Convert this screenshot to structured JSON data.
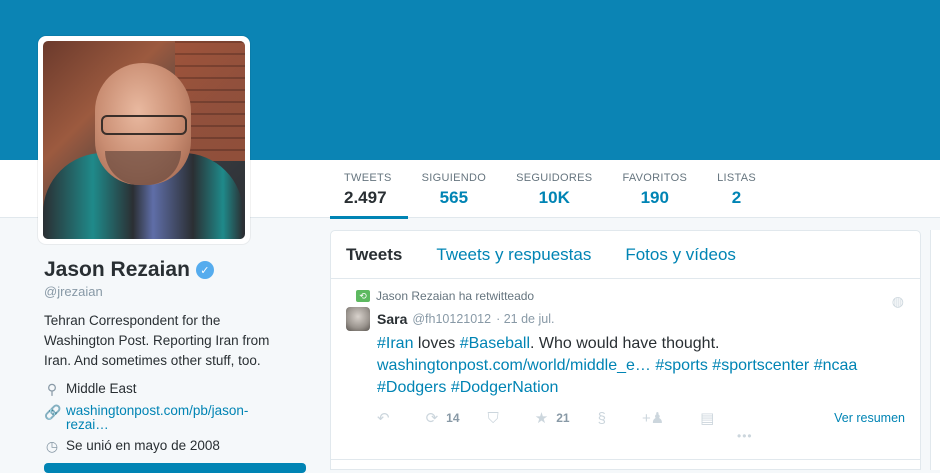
{
  "profile": {
    "name": "Jason Rezaian",
    "verified_glyph": "✓",
    "handle": "@jrezaian",
    "bio": "Tehran Correspondent for the Washington Post. Reporting Iran from Iran. And sometimes other stuff, too.",
    "location": "Middle East",
    "website": "washingtonpost.com/pb/jason-rezai…",
    "joined": "Se unió en mayo de 2008",
    "icons": {
      "location": "pin-icon",
      "website": "link-icon",
      "joined": "clock-icon"
    }
  },
  "stats": [
    {
      "label": "TWEETS",
      "value": "2.497"
    },
    {
      "label": "SIGUIENDO",
      "value": "565"
    },
    {
      "label": "SEGUIDORES",
      "value": "10K"
    },
    {
      "label": "FAVORITOS",
      "value": "190"
    },
    {
      "label": "LISTAS",
      "value": "2"
    }
  ],
  "tabs": [
    "Tweets",
    "Tweets y respuestas",
    "Fotos y vídeos"
  ],
  "tweet": {
    "retweet_note": "Jason Rezaian ha retwitteado",
    "author": "Sara",
    "author_handle": "@fh10121012",
    "date": "· 21 de jul.",
    "text": {
      "t1": "#Iran",
      "t2": " loves ",
      "t3": "#Baseball",
      "t4": ". Who would have thought.",
      "link": "washingtonpost.com/world/middle_e…",
      "h1": "#sports",
      "h2": "#sportscenter",
      "h3": "#ncaa",
      "h4": "#Dodgers",
      "h5": "#DodgerNation"
    },
    "retweets": "14",
    "favorites": "21",
    "summary": "Ver resumen"
  },
  "colors": {
    "accent": "#0084b4",
    "banner": "#0b84b4",
    "retweet": "#5db960"
  }
}
